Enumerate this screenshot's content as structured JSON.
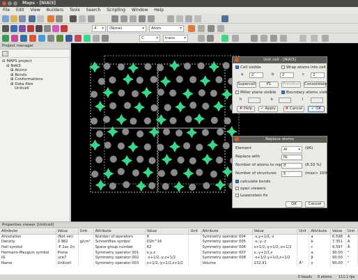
{
  "window": {
    "title": "Maps - [NiAl3]"
  },
  "menu": [
    "File",
    "Edit",
    "View",
    "Builders",
    "Tools",
    "Search",
    "Scripting",
    "Window",
    "Help"
  ],
  "toolbar": {
    "combo_none": "(None)",
    "combo_atom": "Atom",
    "combo_c": "C",
    "combo_trans": "trans",
    "combo_num": "4"
  },
  "project": {
    "header": "Project manager",
    "tree": [
      "MAPS project",
      "NiAl3",
      "Atoms",
      "Bonds",
      "Conformations",
      "Data files",
      "Unitcell"
    ]
  },
  "unitcell_dialog": {
    "title": "Unit cell - [NiAl3]",
    "cell_visible": "Cell visible",
    "wrap_atoms": "Wrap atoms into cell",
    "a_label": "a",
    "a_val": "2",
    "b_label": "b",
    "b_val": "2",
    "c_label": "c",
    "c_val": "2",
    "supercell": "Supercell",
    "p1": "P1",
    "primitive": "Primitive",
    "consolidate": "Consolidate",
    "miller_visible": "Miller plane visible",
    "boundary_visible": "Boundary atoms visible",
    "h_label": "h",
    "k_label": "k",
    "l_label": "l",
    "help": "Help",
    "apply": "Apply",
    "cancel": "Cancel",
    "ok": "OK"
  },
  "replace_dialog": {
    "title": "Replace atoms",
    "element_label": "Element",
    "element_val": "Al",
    "element_count": "(96)",
    "replace_with_label": "Replace with",
    "replace_with_val": "Ni",
    "num_replace_label": "Number of atoms to replace",
    "num_replace_val": "8",
    "num_replace_pct": "(8.33 %)",
    "num_struct_label": "Number of structures",
    "num_struct_val": "5",
    "num_struct_max": "(max> 1000)",
    "calc_bonds": "calculate bonds",
    "open_viewers": "open viewers",
    "lowenstein": "Lowenstein fix",
    "ok": "OK",
    "cancel": "Cancel"
  },
  "properties": {
    "header": "Properties viewer [Unitcell]",
    "columns": [
      "Attribute",
      "Value",
      "Unit",
      "Attribute",
      "Value",
      "Unit",
      "Attribute",
      "Value",
      "Unit",
      "Attribute",
      "Value",
      "Unit"
    ],
    "rows": [
      [
        "Annotation",
        "(Not set)",
        "",
        "Number of operators",
        "8",
        "",
        "Symmetry operator 004",
        "-x,y+1/2,-z",
        "",
        "a",
        "6.598",
        "Å"
      ],
      [
        "Density",
        "3.982",
        "g/cm³",
        "Schoenflies symbol",
        "D2h^16",
        "",
        "Symmetry operator 005",
        "-x,-y,-z",
        "",
        "b",
        "7.351",
        "Å"
      ],
      [
        "Hall symbol",
        "-P 2ac 2n",
        "",
        "Space group number",
        "62",
        "",
        "Symmetry operator 006",
        "x+1/2,-y+1/2,-z+1/2",
        "",
        "c",
        "9.597",
        "Å"
      ],
      [
        "Hermann-Mauguin symbol",
        "Pnma",
        "",
        "Symmetry operator 001",
        "x,y,z",
        "",
        "Symmetry operator 007",
        "x,-y+1/2,z",
        "",
        "α",
        "90.00",
        "°"
      ],
      [
        "ID",
        "uce7",
        "",
        "Symmetry operator 002",
        "-x+1/2,-y,z+1/2",
        "",
        "Symmetry operator 008",
        "-x+1/2,y+1/2,z+1/2",
        "",
        "β",
        "90.00",
        "°"
      ],
      [
        "Name",
        "Unitcell",
        "",
        "Symmetry operator 003",
        "x+1/2,-y+1/2,z+1/2",
        "",
        "Volume",
        "232.91",
        "Å³",
        "γ",
        "90.00",
        "°"
      ]
    ]
  },
  "status": {
    "beads": "0 beads",
    "atoms": "0 atoms",
    "zoom": "111.1 fps"
  },
  "colors": {
    "al_atom": "#3ad68a",
    "ni_atom": "#8a8a8a",
    "accent": "#3a78c4"
  }
}
